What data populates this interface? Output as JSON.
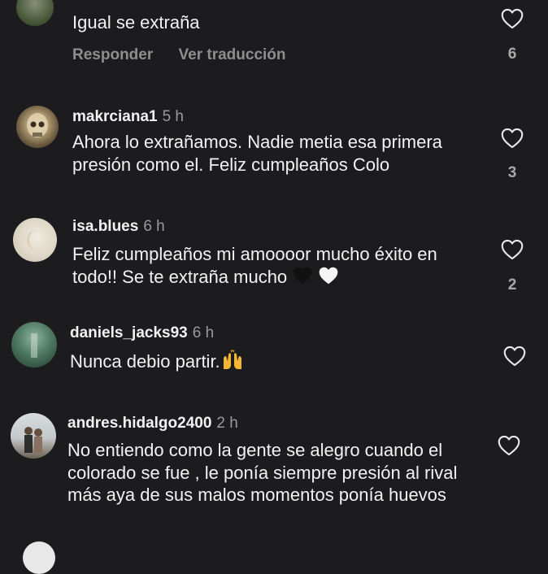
{
  "comments": [
    {
      "username": "",
      "time": "",
      "text": "Igual se extraña",
      "actions": {
        "reply": "Responder",
        "translate": "Ver traducción"
      },
      "likes": "6"
    },
    {
      "username": "makrciana1",
      "time": "5 h",
      "text": "Ahora lo extrañamos. Nadie metia esa primera presión como el. Feliz cumpleaños Colo",
      "likes": "3"
    },
    {
      "username": "isa.blues",
      "time": "6 h",
      "text": "Feliz cumpleaños mi amoooor mucho éxito en todo!! Se te extraña mucho",
      "likes": "2"
    },
    {
      "username": "daniels_jacks93",
      "time": "6 h",
      "text": "Nunca debio partir.",
      "likes": ""
    },
    {
      "username": "andres.hidalgo2400",
      "time": "2 h",
      "text": "No entiendo como la gente se alegro cuando el colorado se fue , le ponía siempre presión al rival más aya de sus malos momentos ponía huevos",
      "likes": ""
    }
  ]
}
